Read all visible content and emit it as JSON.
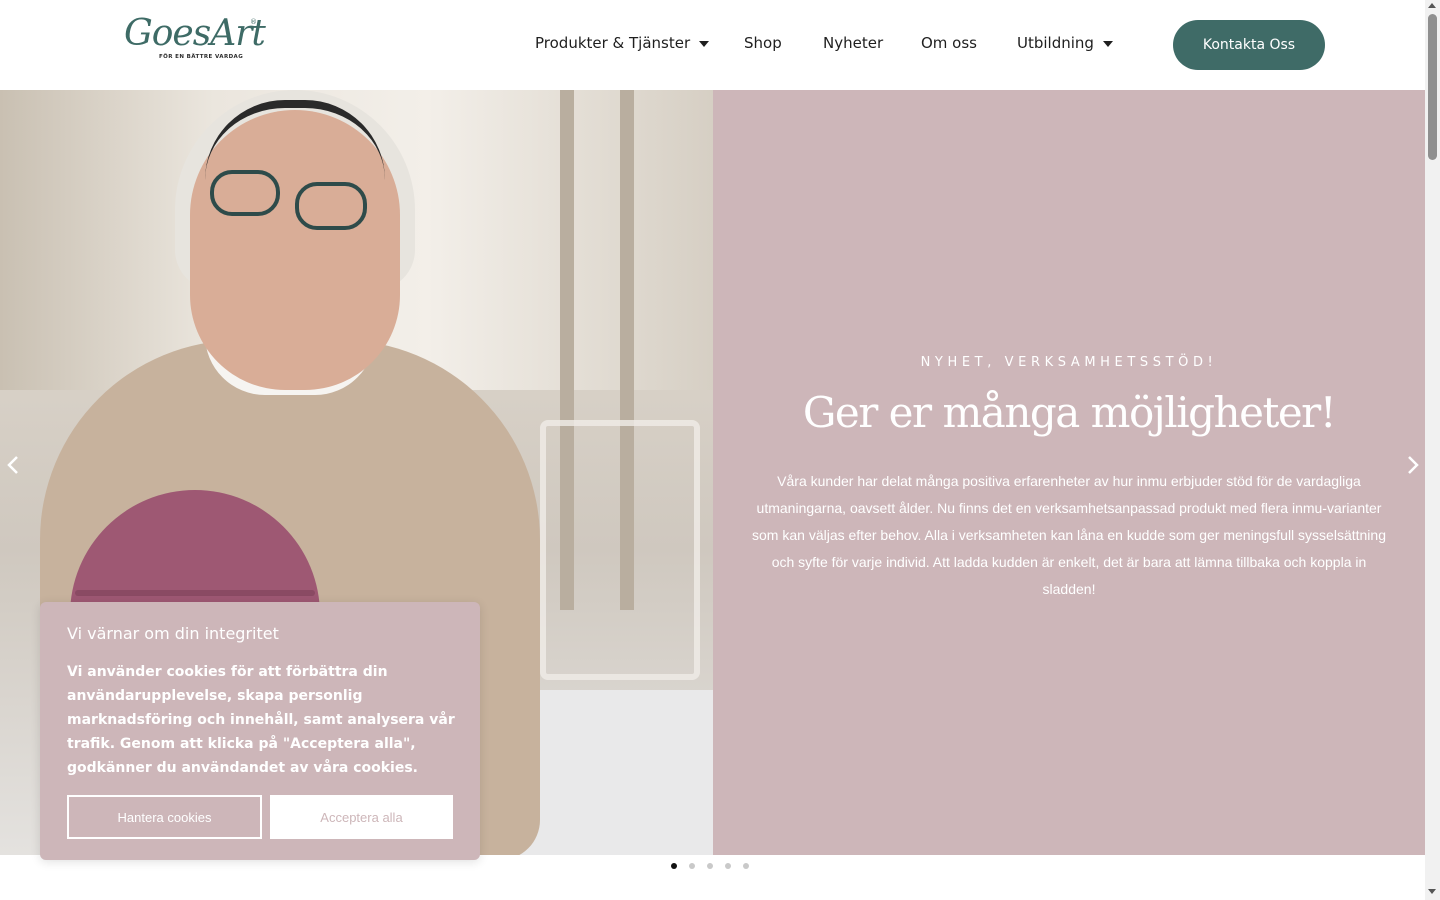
{
  "brand": {
    "logo_text": "GoesArt",
    "registered_mark": "®",
    "tagline": "FÖR EN BÄTTRE VARDAG",
    "colors": {
      "primary": "#3f6b67",
      "panel": "#cdb6b9"
    }
  },
  "nav": {
    "items": [
      {
        "label": "Produkter & Tjänster",
        "has_dropdown": true
      },
      {
        "label": "Shop",
        "has_dropdown": false
      },
      {
        "label": "Nyheter",
        "has_dropdown": false
      },
      {
        "label": "Om oss",
        "has_dropdown": false
      },
      {
        "label": "Utbildning",
        "has_dropdown": true
      }
    ],
    "cta_label": "Kontakta Oss"
  },
  "hero": {
    "eyebrow": "NYHET, VERKSAMHETSSTÖD!",
    "headline": "Ger er många möjligheter!",
    "body": "Våra kunder har delat många positiva erfarenheter av hur inmu erbjuder stöd för de vardagliga utmaningarna, oavsett ålder. Nu finns det en verksamhetsanpassad produkt med flera inmu-varianter som kan väljas efter behov. Alla i verksamheten kan låna en kudde som ger meningsfull sysselsättning och syfte för varje individ. Att ladda kudden är enkelt, det är bara att lämna tillbaka och koppla in sladden!",
    "prev_icon": "chevron-left-icon",
    "next_icon": "chevron-right-icon",
    "slides_total": 5,
    "active_slide": 1
  },
  "cookie": {
    "title": "Vi värnar om din integritet",
    "text": "Vi använder cookies för att förbättra din användarupplevelse, skapa personlig marknadsföring och innehåll, samt analysera vår trafik. Genom att klicka på \"Acceptera alla\", godkänner du användandet av våra cookies.",
    "manage_label": "Hantera cookies",
    "accept_label": "Acceptera alla"
  }
}
